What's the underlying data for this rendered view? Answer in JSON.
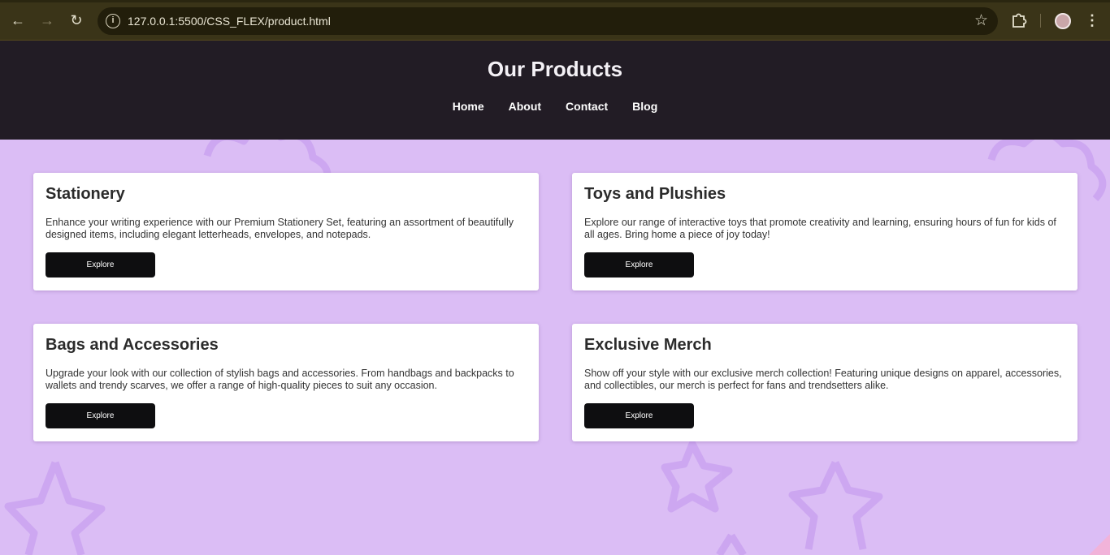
{
  "browser": {
    "url": "127.0.0.1:5500/CSS_FLEX/product.html",
    "back_icon": "back-arrow-icon",
    "forward_icon": "forward-arrow-icon",
    "reload_icon": "reload-icon",
    "bookmark_icon": "star-icon",
    "extensions_icon": "puzzle-icon",
    "menu_icon": "kebab-menu-icon"
  },
  "header": {
    "title": "Our Products",
    "nav": [
      "Home",
      "About",
      "Contact",
      "Blog"
    ]
  },
  "products": [
    {
      "title": "Stationery",
      "description": "Enhance your writing experience with our Premium Stationery Set, featuring an assortment of beautifully designed items, including elegant letterheads, envelopes, and notepads.",
      "button": "Explore"
    },
    {
      "title": "Toys and Plushies",
      "description": "Explore our range of interactive toys that promote creativity and learning, ensuring hours of fun for kids of all ages. Bring home a piece of joy today!",
      "button": "Explore"
    },
    {
      "title": "Bags and Accessories",
      "description": "Upgrade your look with our collection of stylish bags and accessories. From handbags and backpacks to wallets and trendy scarves, we offer a range of high-quality pieces to suit any occasion.",
      "button": "Explore"
    },
    {
      "title": "Exclusive Merch",
      "description": "Show off your style with our exclusive merch collection! Featuring unique designs on apparel, accessories, and collectibles, our merch is perfect for fans and trendsetters alike.",
      "button": "Explore"
    }
  ],
  "colors": {
    "page_background": "#dbbdf5",
    "header_background": "#221c25",
    "button_background": "#0e0e10",
    "decoration_stroke": "#c79ff0"
  }
}
